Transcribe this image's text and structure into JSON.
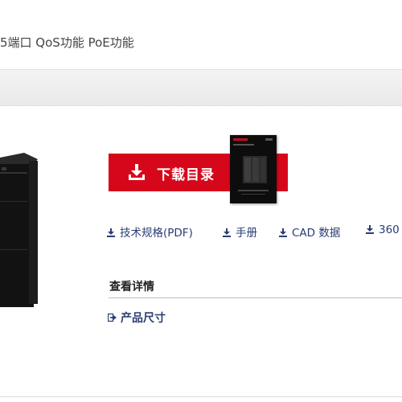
{
  "header": {
    "title": "5端口 QoS功能 PoE功能"
  },
  "download": {
    "label": "下载目录",
    "icon": "download-icon",
    "color": "#d7071b"
  },
  "catalog": {
    "brand": "KEYENCE"
  },
  "links": [
    {
      "label": "技术规格(PDF)",
      "icon": "download-small-icon"
    },
    {
      "label": "手册",
      "icon": "download-small-icon"
    },
    {
      "label": "CAD 数据",
      "icon": "download-small-icon"
    },
    {
      "label": "360",
      "icon": "download-small-icon"
    }
  ],
  "details": {
    "heading": "查看详情",
    "items": [
      {
        "label": "产品尺寸",
        "icon": "arrow-right-icon"
      }
    ]
  },
  "colors": {
    "link": "#2a3d73",
    "accent": "#d7071b"
  }
}
